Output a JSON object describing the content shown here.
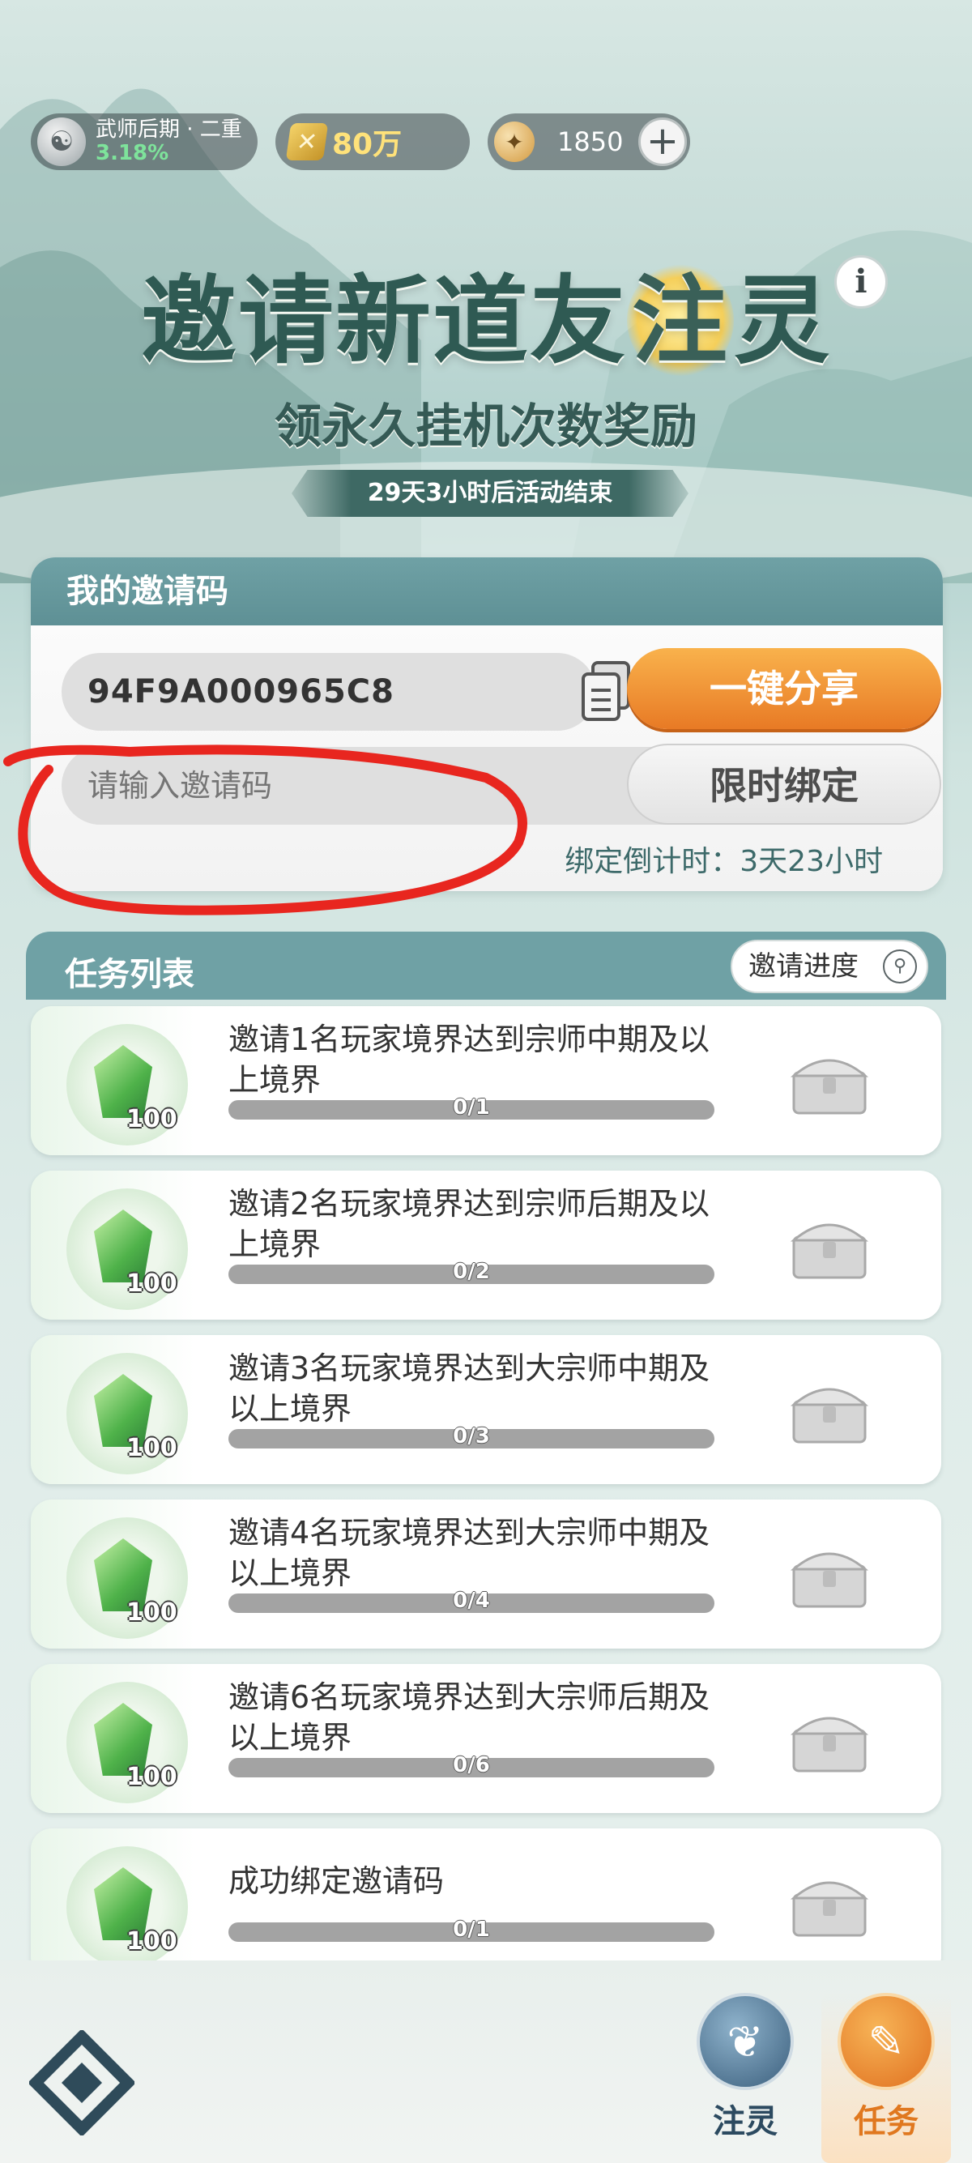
{
  "top_bar": {
    "rank_name": "武师后期 · 二重",
    "rank_progress": "3.18%",
    "coin_value": "80万",
    "gem_value": "1850",
    "plus_label": "+"
  },
  "header": {
    "title_part1": "邀请新道友",
    "title_highlight": "注",
    "title_part2": "灵",
    "subtitle": "领永久挂机次数奖励",
    "event_countdown": "29天3小时后活动结束",
    "info_label": "i"
  },
  "invite_code": {
    "section_title": "我的邀请码",
    "my_code": "94F9A000965C8",
    "share_button": "一键分享",
    "input_placeholder": "请输入邀请码",
    "bind_button": "限时绑定",
    "bind_countdown": "绑定倒计时：3天23小时"
  },
  "tasks": {
    "section_title": "任务列表",
    "progress_button": "邀请进度",
    "items": [
      {
        "desc": "邀请1名玩家境界达到宗师中期及以上境界",
        "reward_qty": "100",
        "progress": "0/1",
        "done": 0
      },
      {
        "desc": "邀请2名玩家境界达到宗师后期及以上境界",
        "reward_qty": "100",
        "progress": "0/2",
        "done": 0
      },
      {
        "desc": "邀请3名玩家境界达到大宗师中期及以上境界",
        "reward_qty": "100",
        "progress": "0/3",
        "done": 0
      },
      {
        "desc": "邀请4名玩家境界达到大宗师中期及以上境界",
        "reward_qty": "100",
        "progress": "0/4",
        "done": 0
      },
      {
        "desc": "邀请6名玩家境界达到大宗师后期及以上境界",
        "reward_qty": "100",
        "progress": "0/6",
        "done": 0
      },
      {
        "desc": "成功绑定邀请码",
        "reward_qty": "100",
        "progress": "0/1",
        "done": 0
      }
    ]
  },
  "bottom_nav": {
    "tab_zhuling": "注灵",
    "tab_task": "任务"
  },
  "colors": {
    "accent_orange": "#e87a25",
    "teal_header": "#6fa1a5",
    "annotation_red": "#e8261f"
  }
}
